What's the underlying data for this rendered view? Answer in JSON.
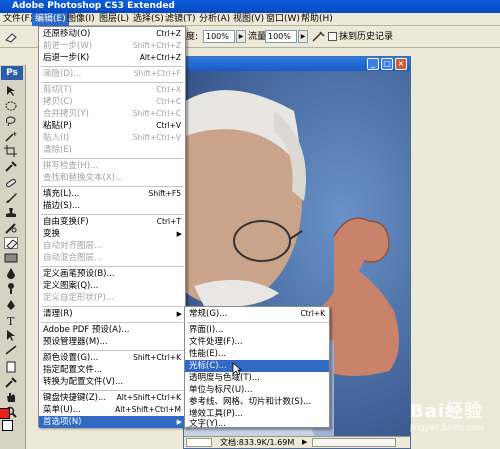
{
  "app": {
    "title": "Adobe Photoshop CS3 Extended"
  },
  "menubar": [
    {
      "label": "文件(F)"
    },
    {
      "label": "编辑(E)"
    },
    {
      "label": "图像(I)"
    },
    {
      "label": "图层(L)"
    },
    {
      "label": "选择(S)"
    },
    {
      "label": "滤镜(T)"
    },
    {
      "label": "分析(A)"
    },
    {
      "label": "视图(V)"
    },
    {
      "label": "窗口(W)"
    },
    {
      "label": "帮助(H)"
    }
  ],
  "options": {
    "opacity_label": "度:",
    "opacity_value": "100%",
    "flow_label": "流量:",
    "flow_value": "100%",
    "history_label": "抹到历史记录"
  },
  "toolbox": {
    "logo": "Ps"
  },
  "edit_menu": [
    {
      "label": "还原移动(O)",
      "shortcut": "Ctrl+Z",
      "enabled": true
    },
    {
      "label": "前进一步(W)",
      "shortcut": "Shift+Ctrl+Z",
      "enabled": false
    },
    {
      "label": "后退一步(K)",
      "shortcut": "Alt+Ctrl+Z",
      "enabled": true
    },
    {
      "label": "渐隐(D)...",
      "shortcut": "Shift+Ctrl+F",
      "enabled": false
    },
    {
      "label": "剪切(T)",
      "shortcut": "Ctrl+X",
      "enabled": false
    },
    {
      "label": "拷贝(C)",
      "shortcut": "Ctrl+C",
      "enabled": false
    },
    {
      "label": "合并拷贝(Y)",
      "shortcut": "Shift+Ctrl+C",
      "enabled": false
    },
    {
      "label": "粘贴(P)",
      "shortcut": "Ctrl+V",
      "enabled": true
    },
    {
      "label": "贴入(I)",
      "shortcut": "Shift+Ctrl+V",
      "enabled": false
    },
    {
      "label": "清除(E)",
      "shortcut": "",
      "enabled": false
    },
    {
      "label": "拼写检查(H)...",
      "shortcut": "",
      "enabled": false
    },
    {
      "label": "查找和替换文本(X)...",
      "shortcut": "",
      "enabled": false
    },
    {
      "label": "填充(L)...",
      "shortcut": "Shift+F5",
      "enabled": true
    },
    {
      "label": "描边(S)...",
      "shortcut": "",
      "enabled": true
    },
    {
      "label": "自由变换(F)",
      "shortcut": "Ctrl+T",
      "enabled": true
    },
    {
      "label": "变换",
      "shortcut": "",
      "enabled": true,
      "submenu": true
    },
    {
      "label": "自动对齐图层...",
      "shortcut": "",
      "enabled": false
    },
    {
      "label": "自动混合图层...",
      "shortcut": "",
      "enabled": false
    },
    {
      "label": "定义画笔预设(B)...",
      "shortcut": "",
      "enabled": true
    },
    {
      "label": "定义图案(Q)...",
      "shortcut": "",
      "enabled": true
    },
    {
      "label": "定义自定形状(P)...",
      "shortcut": "",
      "enabled": false
    },
    {
      "label": "清理(R)",
      "shortcut": "",
      "enabled": true,
      "submenu": true
    },
    {
      "label": "Adobe PDF 预设(A)...",
      "shortcut": "",
      "enabled": true
    },
    {
      "label": "预设管理器(M)...",
      "shortcut": "",
      "enabled": true
    },
    {
      "label": "颜色设置(G)...",
      "shortcut": "Shift+Ctrl+K",
      "enabled": true
    },
    {
      "label": "指定配置文件...",
      "shortcut": "",
      "enabled": true
    },
    {
      "label": "转换为配置文件(V)...",
      "shortcut": "",
      "enabled": true
    },
    {
      "label": "键盘快捷键(Z)...",
      "shortcut": "Alt+Shift+Ctrl+K",
      "enabled": true
    },
    {
      "label": "菜单(U)...",
      "shortcut": "Alt+Shift+Ctrl+M",
      "enabled": true
    },
    {
      "label": "首选项(N)",
      "shortcut": "",
      "enabled": true,
      "submenu": true,
      "selected": true
    }
  ],
  "prefs_submenu": [
    {
      "label": "常规(G)...",
      "shortcut": "Ctrl+K"
    },
    {
      "label": "界面(I)...",
      "shortcut": ""
    },
    {
      "label": "文件处理(F)...",
      "shortcut": ""
    },
    {
      "label": "性能(E)...",
      "shortcut": ""
    },
    {
      "label": "光标(C)...",
      "shortcut": "",
      "selected": true
    },
    {
      "label": "透明度与色域(T)...",
      "shortcut": ""
    },
    {
      "label": "单位与标尺(U)...",
      "shortcut": ""
    },
    {
      "label": "参考线、网格、切片和计数(S)...",
      "shortcut": ""
    },
    {
      "label": "增效工具(P)...",
      "shortcut": ""
    },
    {
      "label": "文字(Y)...",
      "shortcut": ""
    }
  ],
  "document": {
    "status": "文档:833.9K/1.69M"
  },
  "colors": {
    "foreground": "#e8231f",
    "background": "#ffffff",
    "menu_highlight": "#316ac5"
  },
  "watermark": {
    "logo": "Bai经验",
    "url": "jingyan.baidu.com"
  }
}
